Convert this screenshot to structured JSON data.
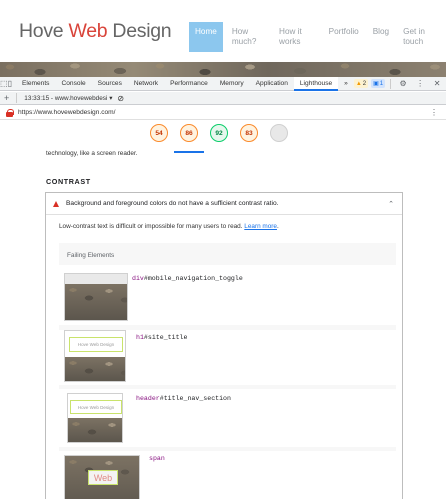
{
  "site": {
    "title_part1": "Hove ",
    "title_accent": "Web",
    "title_part2": " Design",
    "nav": [
      "Home",
      "How much?",
      "How it works",
      "Portfolio",
      "Blog",
      "Get in touch"
    ]
  },
  "devtools": {
    "tabs": [
      "Elements",
      "Console",
      "Sources",
      "Network",
      "Performance",
      "Memory",
      "Application",
      "Lighthouse"
    ],
    "active_tab": "Lighthouse",
    "more": "»",
    "warnings_count": "2",
    "info_count": "1",
    "report_selector": "13:33:15 - www.hovewebdesi",
    "url": "https://www.hovewebdesign.com/"
  },
  "scores": [
    "54",
    "86",
    "92",
    "83",
    ""
  ],
  "report": {
    "partial_text": "technology, like a screen reader.",
    "section_title": "CONTRAST",
    "audit_title": "Background and foreground colors do not have a sufficient contrast ratio.",
    "audit_desc": "Low-contrast text is difficult or impossible for many users to read. ",
    "learn_more": "Learn more",
    "learn_more_suffix": ".",
    "failing_title": "Failing Elements",
    "items": [
      {
        "tag": "div",
        "rest": "#mobile_navigation_toggle"
      },
      {
        "tag": "h1",
        "rest": "#site_title"
      },
      {
        "tag": "header",
        "rest": "#title_nav_section"
      },
      {
        "tag": "span",
        "rest": ""
      }
    ],
    "thumb_text_site": "Hove Web Design",
    "thumb_text_web": "Web"
  },
  "colors": {
    "accent_red": "#d9443a",
    "nav_active": "#8cc7ee",
    "score_orange": "#fa8b2d",
    "score_green": "#0cce6b",
    "link_blue": "#1a73e8"
  }
}
